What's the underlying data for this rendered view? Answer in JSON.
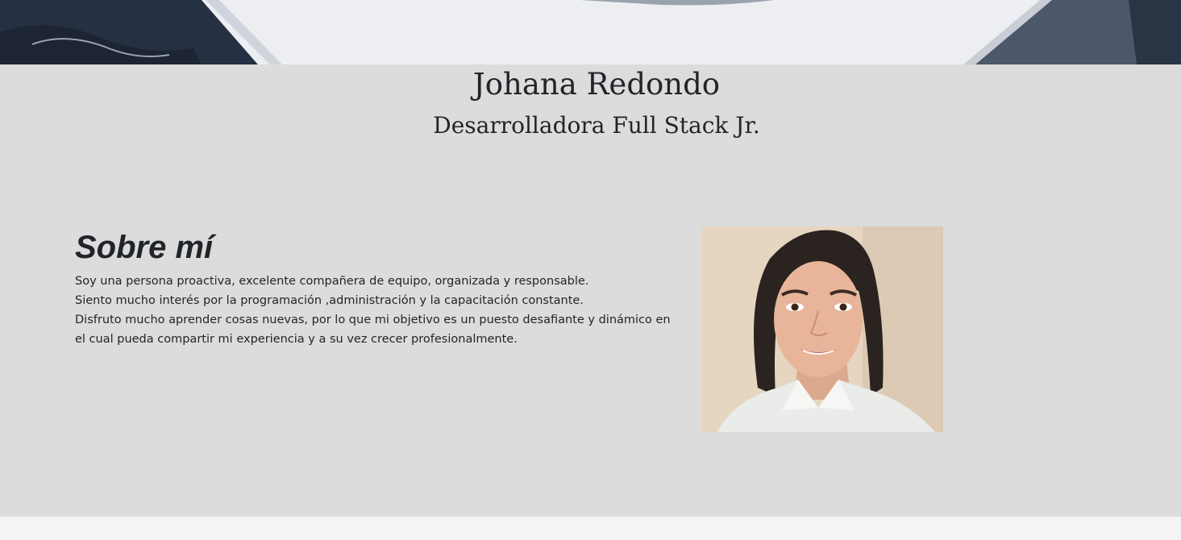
{
  "hero": {
    "image_alt": "office desk background"
  },
  "profile": {
    "name": "Johana Redondo",
    "role": "Desarrolladora Full Stack Jr."
  },
  "about": {
    "title": "Sobre mí",
    "paragraphs": [
      "Soy una persona proactiva, excelente compañera de equipo, organizada y responsable.",
      "Siento mucho interés por la programación ,administración y la capacitación constante.",
      "Disfruto mucho aprender cosas nuevas, por lo que mi objetivo es un puesto desafiante y dinámico en el cual pueda compartir mi experiencia y a su vez crecer profesionalmente."
    ],
    "photo_alt": "Foto de Johana Redondo"
  },
  "colors": {
    "section_bg": "#dcdcdc",
    "text": "#212529",
    "page_bg": "#f4f4f4"
  }
}
